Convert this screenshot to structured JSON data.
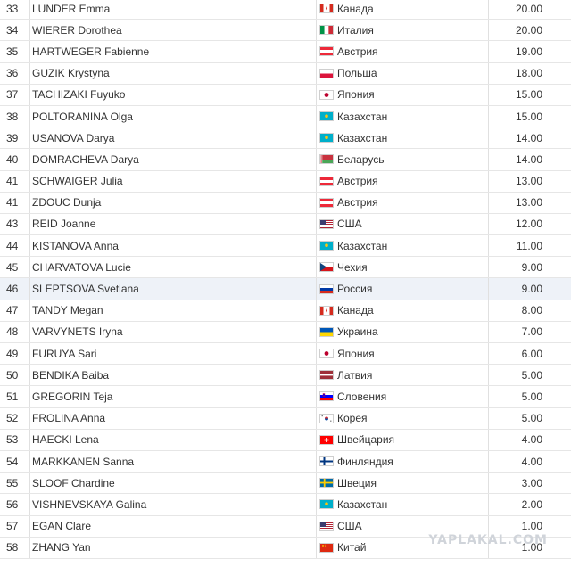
{
  "rows": [
    {
      "rank": "33",
      "name": "LUNDER Emma",
      "country": "Канада",
      "points": "20.00",
      "flag": "canada-flag-icon"
    },
    {
      "rank": "34",
      "name": "WIERER Dorothea",
      "country": "Италия",
      "points": "20.00",
      "flag": "italy-flag-icon"
    },
    {
      "rank": "35",
      "name": "HARTWEGER Fabienne",
      "country": "Австрия",
      "points": "19.00",
      "flag": "austria-flag-icon"
    },
    {
      "rank": "36",
      "name": "GUZIK Krystyna",
      "country": "Польша",
      "points": "18.00",
      "flag": "poland-flag-icon"
    },
    {
      "rank": "37",
      "name": "TACHIZAKI Fuyuko",
      "country": "Япония",
      "points": "15.00",
      "flag": "japan-flag-icon"
    },
    {
      "rank": "38",
      "name": "POLTORANINA Olga",
      "country": "Казахстан",
      "points": "15.00",
      "flag": "kazakhstan-flag-icon"
    },
    {
      "rank": "39",
      "name": "USANOVA Darya",
      "country": "Казахстан",
      "points": "14.00",
      "flag": "kazakhstan-flag-icon"
    },
    {
      "rank": "40",
      "name": "DOMRACHEVA Darya",
      "country": "Беларусь",
      "points": "14.00",
      "flag": "belarus-flag-icon"
    },
    {
      "rank": "41",
      "name": "SCHWAIGER Julia",
      "country": "Австрия",
      "points": "13.00",
      "flag": "austria-flag-icon"
    },
    {
      "rank": "41",
      "name": "ZDOUC Dunja",
      "country": "Австрия",
      "points": "13.00",
      "flag": "austria-flag-icon"
    },
    {
      "rank": "43",
      "name": "REID Joanne",
      "country": "США",
      "points": "12.00",
      "flag": "usa-flag-icon"
    },
    {
      "rank": "44",
      "name": "KISTANOVA Anna",
      "country": "Казахстан",
      "points": "11.00",
      "flag": "kazakhstan-flag-icon"
    },
    {
      "rank": "45",
      "name": "CHARVATOVA Lucie",
      "country": "Чехия",
      "points": "9.00",
      "flag": "czech-flag-icon"
    },
    {
      "rank": "46",
      "name": "SLEPTSOVA Svetlana",
      "country": "Россия",
      "points": "9.00",
      "flag": "russia-flag-icon",
      "highlight": true
    },
    {
      "rank": "47",
      "name": "TANDY Megan",
      "country": "Канада",
      "points": "8.00",
      "flag": "canada-flag-icon"
    },
    {
      "rank": "48",
      "name": "VARVYNETS Iryna",
      "country": "Украина",
      "points": "7.00",
      "flag": "ukraine-flag-icon"
    },
    {
      "rank": "49",
      "name": "FURUYA Sari",
      "country": "Япония",
      "points": "6.00",
      "flag": "japan-flag-icon"
    },
    {
      "rank": "50",
      "name": "BENDIKA Baiba",
      "country": "Латвия",
      "points": "5.00",
      "flag": "latvia-flag-icon"
    },
    {
      "rank": "51",
      "name": "GREGORIN Teja",
      "country": "Словения",
      "points": "5.00",
      "flag": "slovenia-flag-icon"
    },
    {
      "rank": "52",
      "name": "FROLINA Anna",
      "country": "Корея",
      "points": "5.00",
      "flag": "korea-flag-icon"
    },
    {
      "rank": "53",
      "name": "HAECKI Lena",
      "country": "Швейцария",
      "points": "4.00",
      "flag": "switzerland-flag-icon"
    },
    {
      "rank": "54",
      "name": "MARKKANEN Sanna",
      "country": "Финляндия",
      "points": "4.00",
      "flag": "finland-flag-icon"
    },
    {
      "rank": "55",
      "name": "SLOOF Chardine",
      "country": "Швеция",
      "points": "3.00",
      "flag": "sweden-flag-icon"
    },
    {
      "rank": "56",
      "name": "VISHNEVSKAYA Galina",
      "country": "Казахстан",
      "points": "2.00",
      "flag": "kazakhstan-flag-icon"
    },
    {
      "rank": "57",
      "name": "EGAN Clare",
      "country": "США",
      "points": "1.00",
      "flag": "usa-flag-icon"
    },
    {
      "rank": "58",
      "name": "ZHANG Yan",
      "country": "Китай",
      "points": "1.00",
      "flag": "china-flag-icon"
    }
  ],
  "watermark": "YAPLAKAL.COM",
  "colors": {
    "text": "#333333",
    "highlight_row": "#eef2f8",
    "border": "#e0e0e0",
    "watermark": "#d0d4da"
  }
}
